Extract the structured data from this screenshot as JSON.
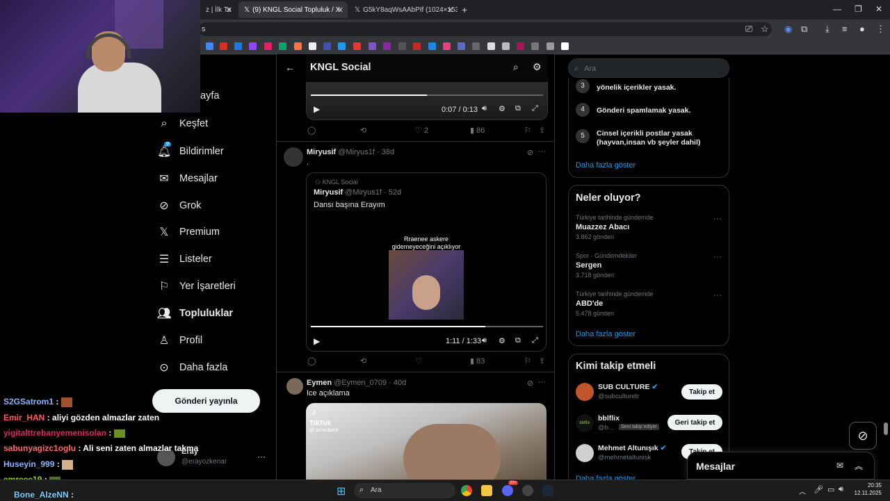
{
  "browser": {
    "tabs": [
      {
        "label": "z | İlk Ta"
      },
      {
        "label": "(9) KNGL Social Topluluk / X"
      },
      {
        "label": "G5kY8aqWsAAbPIf (1024×153"
      }
    ],
    "address": "s"
  },
  "nav": {
    "items": [
      {
        "label": "ayfa",
        "icon": "home-icon"
      },
      {
        "label": "Keşfet",
        "icon": "search-icon"
      },
      {
        "label": "Bildirimler",
        "icon": "bell-icon",
        "badge": "9"
      },
      {
        "label": "Mesajlar",
        "icon": "mail-icon"
      },
      {
        "label": "Grok",
        "icon": "grok-icon"
      },
      {
        "label": "Premium",
        "icon": "x-logo-icon"
      },
      {
        "label": "Listeler",
        "icon": "list-icon"
      },
      {
        "label": "Yer İşaretleri",
        "icon": "bookmark-icon"
      },
      {
        "label": "Topluluklar",
        "icon": "communities-icon"
      },
      {
        "label": "Profil",
        "icon": "person-icon"
      },
      {
        "label": "Daha fazla",
        "icon": "more-circle-icon"
      }
    ],
    "post_button": "Gönderi yayınla",
    "account": {
      "name": "Eray",
      "handle": "@erayozkenar"
    }
  },
  "chat": [
    {
      "user": "S2GSatrom1",
      "msg": ":",
      "color": "#8ab4f8"
    },
    {
      "user": "Emir_HAN",
      "msg": ": aliyi gözden almazlar zaten",
      "color": "#ff5c5c"
    },
    {
      "user": "yigitalttrebanyemenisolan",
      "msg": ":",
      "color": "#e0245e"
    },
    {
      "user": "sabunyagizc1oglu",
      "msg": ": Ali seni zaten almazlar takma",
      "color": "#ff6b6b"
    },
    {
      "user": "Huseyin_999",
      "msg": ":",
      "color": "#8ab4f8"
    },
    {
      "user": "emreee19",
      "msg": ":",
      "color": "#9acd32"
    },
    {
      "user": "Bone_AlzeNN",
      "msg": ":",
      "color": "#7fd1ff"
    }
  ],
  "main": {
    "header_title": "KNGL Social",
    "post1": {
      "time": "0:07 / 0:13",
      "likes": "2",
      "views": "86",
      "progress": 0.5
    },
    "post2": {
      "name": "Miryusif",
      "handle": "@Miryus1f",
      "age": "· 38d",
      "text": ".",
      "community": "KNGL Social",
      "quote_name": "Miryusif",
      "quote_handle": "@Miryus1f",
      "quote_age": "· 52d",
      "quote_text": "Dansı başına Erayım",
      "video_caption": "Rraenee askere gidemeyeceğini açıklıyor",
      "time": "1:11 / 1:33",
      "progress": 0.75,
      "views": "83"
    },
    "post3": {
      "name": "Eymen",
      "handle": "@Eymen_0709",
      "age": "· 40d",
      "text": "Ice açıklama",
      "tiktok": "TikTok",
      "tiktok_user": "@ senedion4"
    }
  },
  "right": {
    "search_placeholder": "Ara",
    "rules": [
      {
        "num": "3",
        "text": "yönelik içerikler yasak."
      },
      {
        "num": "4",
        "text": "Gönderi spamlamak yasak."
      },
      {
        "num": "5",
        "text": "Cinsel içerikli postlar yasak (hayvan,insan vb şeyler dahil)"
      }
    ],
    "rules_more": "Daha fazla göster",
    "trends_title": "Neler oluyor?",
    "trends": [
      {
        "context": "Türkiye tarihinde gündemde",
        "name": "Muazzez Abacı",
        "count": "3.862 gönderi"
      },
      {
        "context": "Spor · Gündemdekiler",
        "name": "Sergen",
        "count": "3.718 gönderi"
      },
      {
        "context": "Türkiye tarihinde gündemde",
        "name": "ABD'de",
        "count": "5.478 gönderi"
      }
    ],
    "trends_more": "Daha fazla göster",
    "who_title": "Kimi takip etmeli",
    "who": [
      {
        "name": "SUB CULTURE",
        "handle": "@subculturetr",
        "button": "Takip et"
      },
      {
        "name": "bblflix",
        "handle": "@b...",
        "tag": "Seni takip ediyor",
        "button": "Geri takip et"
      },
      {
        "name": "Mehmet Altunışık",
        "handle": "@mehmetaltunisk",
        "button": "Takip et"
      }
    ],
    "who_more": "Daha fazla göster",
    "messages_label": "Mesajlar"
  },
  "taskbar": {
    "search": "Ara",
    "time": "20:35",
    "date": "12.11.2025",
    "badge": "99+"
  },
  "colors": {
    "accent": "#1d9bf0",
    "bg": "#000000",
    "border": "#2f3336"
  }
}
